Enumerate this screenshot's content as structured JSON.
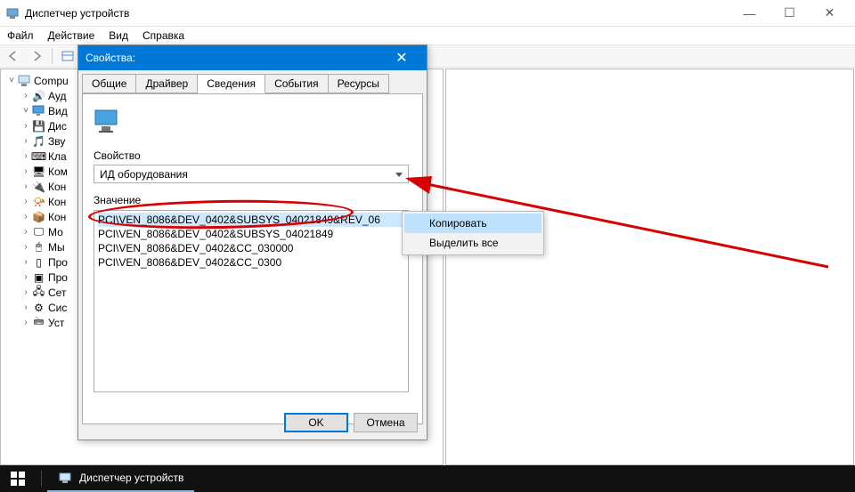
{
  "window": {
    "title": "Диспетчер устройств",
    "menus": [
      "Файл",
      "Действие",
      "Вид",
      "Справка"
    ]
  },
  "tree": {
    "root": "Compu",
    "items": [
      "Ауд",
      "Вид",
      "Дис",
      "Зву",
      "Кла",
      "Ком",
      "Кон",
      "Кон",
      "Кон",
      "Мо",
      "Мы",
      "Про",
      "Про",
      "Сет",
      "Сис",
      "Уст"
    ]
  },
  "dialog": {
    "title": "Свойства:",
    "tabs": [
      "Общие",
      "Драйвер",
      "Сведения",
      "События",
      "Ресурсы"
    ],
    "active_tab": "Сведения",
    "property_label": "Свойство",
    "property_value": "ИД оборудования",
    "value_label": "Значение",
    "values": [
      "PCI\\VEN_8086&DEV_0402&SUBSYS_04021849&REV_06",
      "PCI\\VEN_8086&DEV_0402&SUBSYS_04021849",
      "PCI\\VEN_8086&DEV_0402&CC_030000",
      "PCI\\VEN_8086&DEV_0402&CC_0300"
    ],
    "ok": "OK",
    "cancel": "Отмена"
  },
  "context_menu": {
    "copy": "Копировать",
    "select_all": "Выделить все"
  },
  "taskbar": {
    "app": "Диспетчер устройств"
  }
}
